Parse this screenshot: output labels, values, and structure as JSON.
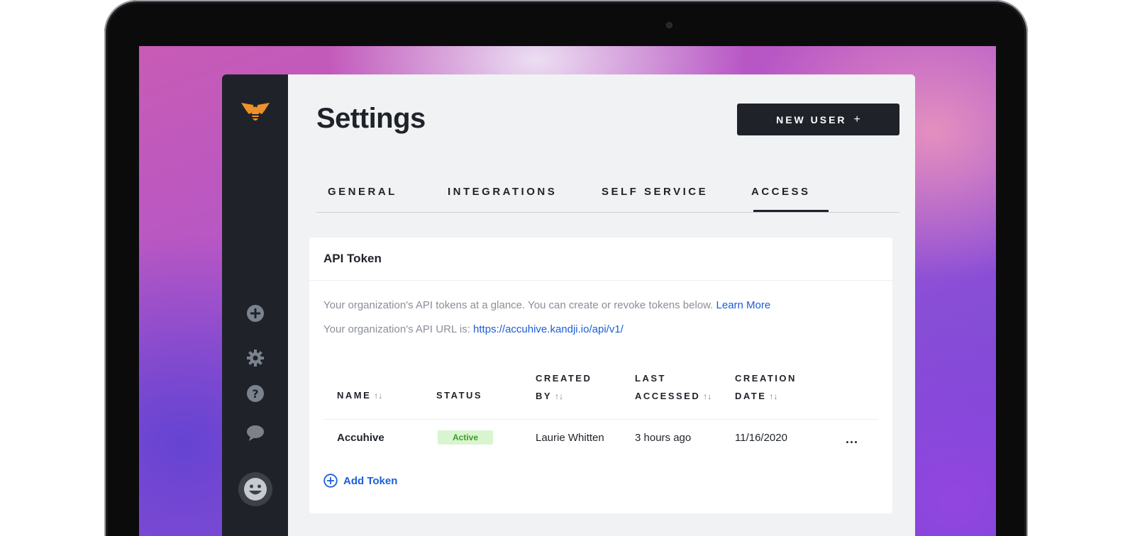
{
  "app": {
    "title": "Settings",
    "new_user_label": "NEW USER",
    "new_user_icon": "+"
  },
  "tabs": [
    {
      "label": "GENERAL",
      "active": false
    },
    {
      "label": "INTEGRATIONS",
      "active": false
    },
    {
      "label": "SELF SERVICE",
      "active": false
    },
    {
      "label": "ACCESS",
      "active": true
    }
  ],
  "sidebar": {
    "icons": [
      "bee-logo-icon",
      "add-circle-icon",
      "gear-icon",
      "help-icon",
      "chat-icon",
      "smiley-avatar-icon"
    ]
  },
  "api_token": {
    "title": "API Token",
    "description": "Your organization's API tokens at a glance. You can create or revoke tokens below.",
    "learn_more": "Learn More",
    "url_prefix": "Your organization's API URL is:",
    "url": "https://accuhive.kandji.io/api/v1/",
    "columns": {
      "name": "NAME",
      "status": "STATUS",
      "created_by_1": "CREATED",
      "created_by_2": "BY",
      "last_accessed_1": "LAST",
      "last_accessed_2": "ACCESSED",
      "creation_date_1": "CREATION",
      "creation_date_2": "DATE",
      "sort_icon": "↑↓"
    },
    "rows": [
      {
        "name": "Accuhive",
        "status": "Active",
        "created_by": "Laurie Whitten",
        "last_accessed": "3 hours ago",
        "creation_date": "11/16/2020",
        "more": "..."
      }
    ],
    "add_token": "Add Token"
  },
  "colors": {
    "sidebar_bg": "#1f2329",
    "accent_link": "#1a5ed8",
    "logo_orange": "#f0922b",
    "status_active_bg": "#d8f5cf",
    "status_active_text": "#3f9a2a"
  }
}
